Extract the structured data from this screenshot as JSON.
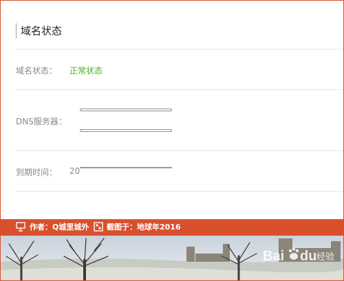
{
  "panel": {
    "title": "域名状态",
    "status_label": "域名状态：",
    "status_value": "正常状态",
    "dns_label": "DNS服务器：",
    "expire_label": "到期时间：",
    "expire_prefix": "20"
  },
  "footer": {
    "author": "作者：Q城里城外",
    "screenshot": "截图于：地球年2016"
  },
  "watermark": {
    "brand": "Bai",
    "brand_suffix": "du",
    "subtitle": "经验"
  },
  "colors": {
    "accent": "#d9502c",
    "status_ok": "#4cae1f"
  }
}
